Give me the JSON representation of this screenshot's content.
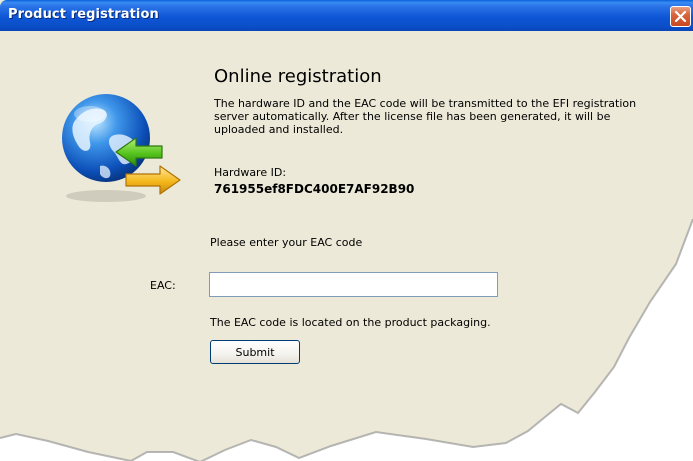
{
  "window": {
    "title": "Product registration",
    "close_icon": "close-icon",
    "colors": {
      "titlebar": "#0b4ec8",
      "body": "#ece9d8",
      "close": "#d9643d"
    }
  },
  "content": {
    "icon": "globe-transfer-icon",
    "heading": "Online registration",
    "description": "The hardware ID and the EAC code will be transmitted to the EFI registration server automatically. After the license file has been generated, it will be uploaded and installed.",
    "hardware_id_label": "Hardware ID:",
    "hardware_id_value": "761955ef8FDC400E7AF92B90",
    "prompt": "Please enter your EAC code",
    "eac_label": "EAC:",
    "eac_value": "",
    "eac_note": "The EAC code is located on the product packaging.",
    "submit_label": "Submit"
  }
}
